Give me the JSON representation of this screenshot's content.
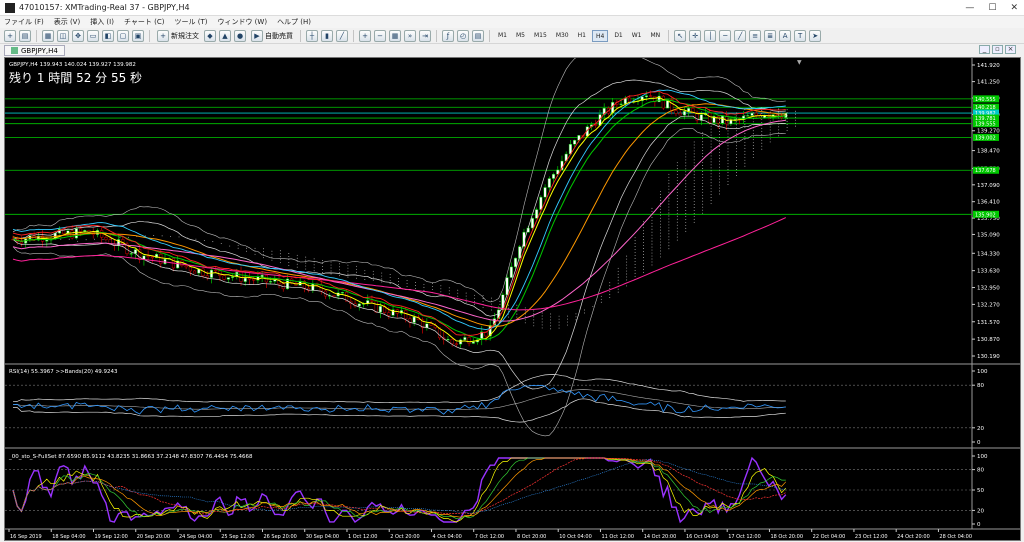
{
  "window": {
    "title": "47010157: XMTrading-Real 37 - GBPJPY,H4",
    "controls": [
      "—",
      "☐",
      "✕"
    ]
  },
  "menu": [
    "ファイル (F)",
    "表示 (V)",
    "挿入 (I)",
    "チャート (C)",
    "ツール (T)",
    "ウィンドウ (W)",
    "ヘルプ (H)"
  ],
  "toolbar": {
    "new_order_label": "新規注文",
    "auto_trade_label": "自動売買",
    "timeframes": [
      "M1",
      "M5",
      "M15",
      "M30",
      "H1",
      "H4",
      "D1",
      "W1",
      "MN"
    ],
    "active_timeframe": "H4"
  },
  "chart_tab": {
    "label": "GBPJPY,H4"
  },
  "main": {
    "symbol_line": "GBPJPY,H4  139.943 140.024 139.927 139.982",
    "countdown": "残り 1 時間 52 分 55 秒",
    "price_ticks": [
      "141.920",
      "141.250",
      "140.590",
      "139.930",
      "139.270",
      "138.470",
      "137.750",
      "137.090",
      "136.410",
      "135.750",
      "135.090",
      "134.330",
      "133.630",
      "132.950",
      "132.270",
      "131.570",
      "130.870",
      "130.190"
    ],
    "price_tags": [
      {
        "text": "140.555",
        "color": "#00c800"
      },
      {
        "text": "140.218",
        "color": "#00c800"
      },
      {
        "text": "139.982",
        "color": "#00c8c8"
      },
      {
        "text": "139.781",
        "color": "#00c800"
      },
      {
        "text": "139.555",
        "color": "#00c800"
      },
      {
        "text": "139.002",
        "color": "#00c800"
      },
      {
        "text": "137.678",
        "color": "#00c800"
      },
      {
        "text": "135.902",
        "color": "#00c800"
      }
    ]
  },
  "rsi": {
    "label": "RSI(14) 55.3967  >>Bands(20) 49.9243",
    "levels": [
      "100",
      "80",
      "20",
      "0"
    ]
  },
  "stoch": {
    "label": "_00_sto_S-FullSet 87.6590 85.9112 43.8235 31.8663 37.2148 47.8307 76.4454 75.4668",
    "levels": [
      "100",
      "80",
      "50",
      "20",
      "0"
    ]
  },
  "time_labels": [
    "16 Sep 2019",
    "18 Sep 04:00",
    "19 Sep 12:00",
    "20 Sep 20:00",
    "24 Sep 04:00",
    "25 Sep 12:00",
    "26 Sep 20:00",
    "30 Sep 04:00",
    "1 Oct 12:00",
    "2 Oct 20:00",
    "4 Oct 04:00",
    "7 Oct 12:00",
    "8 Oct 20:00",
    "10 Oct 04:00",
    "11 Oct 12:00",
    "14 Oct 20:00",
    "16 Oct 04:00",
    "17 Oct 12:00",
    "18 Oct 20:00",
    "22 Oct 04:00",
    "23 Oct 12:00",
    "24 Oct 20:00",
    "28 Oct 04:00"
  ],
  "colors": {
    "background": "#000000",
    "candle_up": "#00c800",
    "candle_down": "#d00000",
    "grid": "#1a3a1a",
    "text": "#ffffff"
  }
}
